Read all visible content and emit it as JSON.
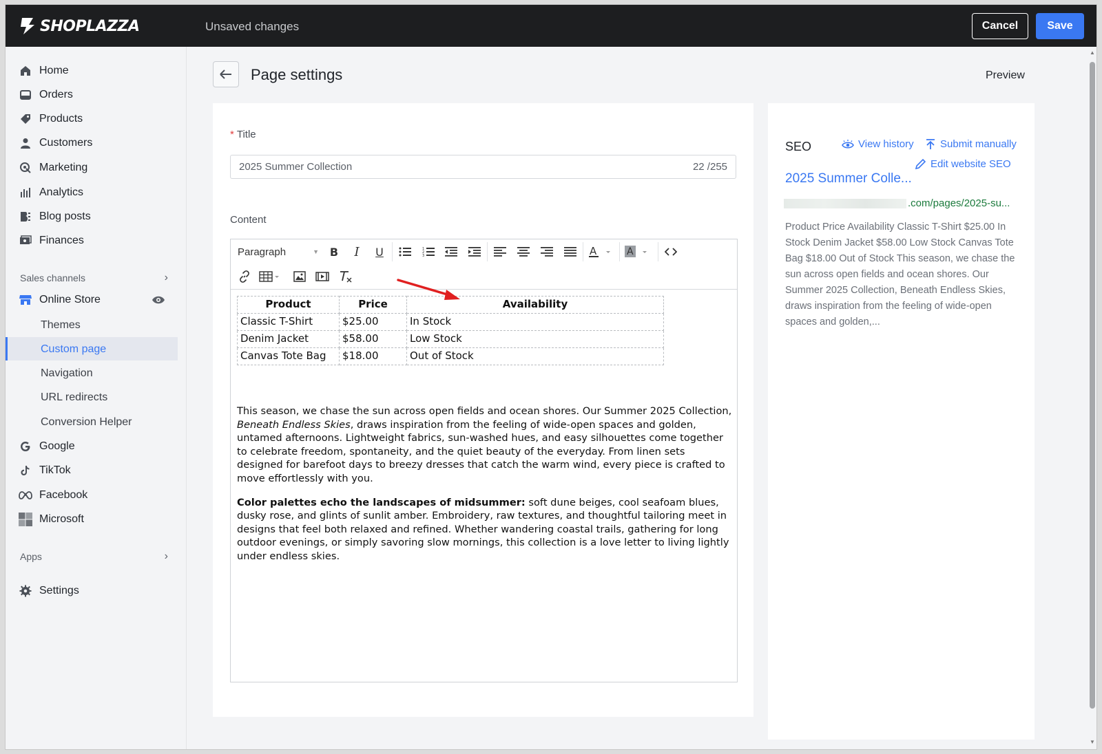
{
  "topbar": {
    "logo_text": "SHOPLAZZA",
    "status": "Unsaved changes",
    "cancel_label": "Cancel",
    "save_label": "Save"
  },
  "sidebar": {
    "items": [
      {
        "label": "Home",
        "icon": "home-icon"
      },
      {
        "label": "Orders",
        "icon": "orders-icon"
      },
      {
        "label": "Products",
        "icon": "tag-icon"
      },
      {
        "label": "Customers",
        "icon": "person-icon"
      },
      {
        "label": "Marketing",
        "icon": "marketing-icon"
      },
      {
        "label": "Analytics",
        "icon": "bar-chart-icon"
      },
      {
        "label": "Blog posts",
        "icon": "blog-icon"
      },
      {
        "label": "Finances",
        "icon": "finances-icon"
      }
    ],
    "sales_channels_label": "Sales channels",
    "online_store_label": "Online Store",
    "sub_items": [
      "Themes",
      "Custom page",
      "Navigation",
      "URL redirects",
      "Conversion Helper"
    ],
    "channels": [
      {
        "label": "Google",
        "icon": "google-icon"
      },
      {
        "label": "TikTok",
        "icon": "tiktok-icon"
      },
      {
        "label": "Facebook",
        "icon": "meta-icon"
      },
      {
        "label": "Microsoft",
        "icon": "microsoft-icon"
      }
    ],
    "apps_label": "Apps",
    "settings_label": "Settings",
    "accent": "#3a78f2"
  },
  "main": {
    "page_title": "Page settings",
    "preview_label": "Preview",
    "title_label": "Title",
    "title_value": "2025 Summer Collection",
    "title_counter": "22 /255",
    "content_label": "Content",
    "toolbar": {
      "block_format": "Paragraph"
    },
    "table": {
      "headers": [
        "Product",
        "Price",
        "Availability"
      ],
      "rows": [
        [
          "Classic T-Shirt",
          "$25.00",
          "In Stock"
        ],
        [
          "Denim Jacket",
          "$58.00",
          "Low Stock"
        ],
        [
          "Canvas Tote Bag",
          "$18.00",
          "Out of Stock"
        ]
      ]
    },
    "para1_a": "This season, we chase the sun across open fields and ocean shores. Our Summer 2025 Collection, ",
    "para1_em": "Beneath Endless Skies",
    "para1_b": ", draws inspiration from the feeling of wide-open spaces and golden, untamed afternoons. Lightweight fabrics, sun-washed hues, and easy silhouettes come together to celebrate freedom, spontaneity, and the quiet beauty of the everyday. From linen sets designed for barefoot days to breezy dresses that catch the warm wind, every piece is crafted to move effortlessly with you.",
    "para2_strong": "Color palettes echo the landscapes of midsummer:",
    "para2_rest": " soft dune beiges, cool seafoam blues, dusky rose, and glints of sunlit amber. Embroidery, raw textures, and thoughtful tailoring meet in designs that feel both relaxed and refined. Whether wandering coastal trails, gathering for long outdoor evenings, or simply savoring slow mornings, this collection is a love letter to living lightly under endless skies."
  },
  "seo": {
    "label": "SEO",
    "view_history": "View history",
    "submit_manually": "Submit manually",
    "edit_seo": "Edit website SEO",
    "link_title": "2025 Summer Colle...",
    "url_suffix": ".com/pages/2025-su...",
    "description": "Product Price Availability Classic T-Shirt $25.00 In Stock Denim Jacket $58.00 Low Stock Canvas Tote Bag $18.00 Out of Stock This season, we chase the sun across open fields and ocean shores. Our Summer 2025 Collection, Beneath Endless Skies, draws inspiration from the feeling of wide-open spaces and golden,..."
  }
}
